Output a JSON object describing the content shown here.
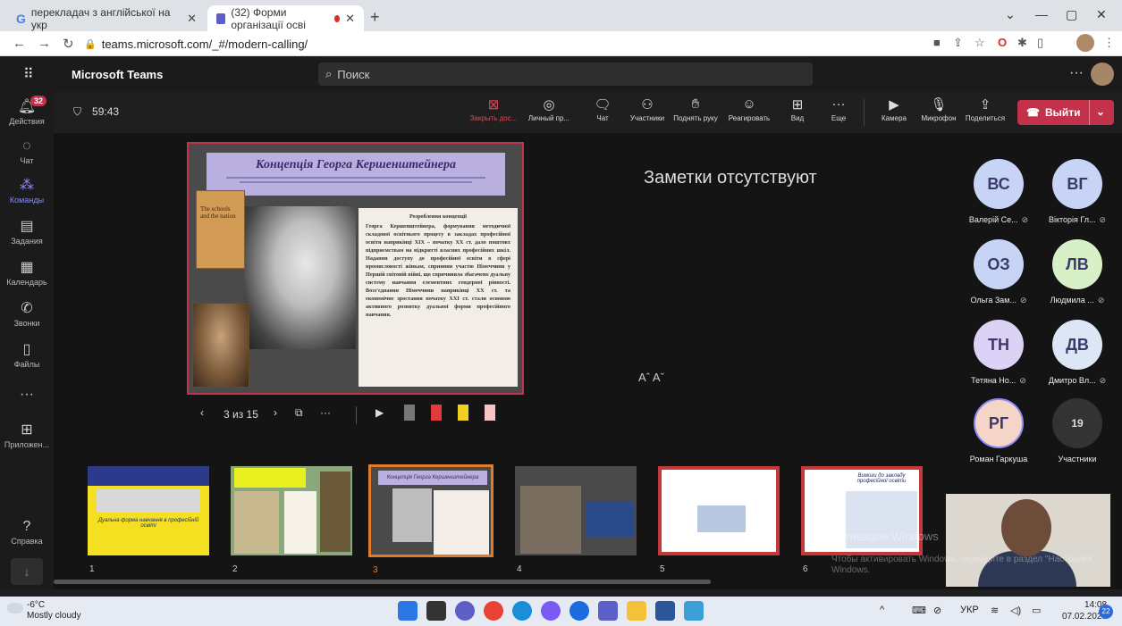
{
  "browser": {
    "tabs": [
      {
        "label": "перекладач з англійської на укр"
      },
      {
        "label": "(32) Форми організації осві"
      }
    ],
    "url": "teams.microsoft.com/_#/modern-calling/"
  },
  "teams": {
    "app_title": "Microsoft Teams",
    "search_placeholder": "Поиск",
    "rail": [
      {
        "label": "Действия",
        "badge": "32",
        "icon": "bell-icon"
      },
      {
        "label": "Чат",
        "icon": "chat-icon"
      },
      {
        "label": "Команды",
        "icon": "teams-icon"
      },
      {
        "label": "Задания",
        "icon": "assignments-icon"
      },
      {
        "label": "Календарь",
        "icon": "calendar-icon"
      },
      {
        "label": "Звонки",
        "icon": "phone-icon"
      },
      {
        "label": "Файлы",
        "icon": "file-icon"
      },
      {
        "label": "Приложен...",
        "icon": "apps-icon"
      },
      {
        "label": "Справка",
        "icon": "help-icon"
      }
    ]
  },
  "meeting": {
    "timer": "59:43",
    "controls": [
      {
        "label": "Закрыть дос...",
        "icon": "close-share-icon"
      },
      {
        "label": "Личный пр...",
        "icon": "eye-icon"
      },
      {
        "label": "Чат",
        "icon": "chat-icon"
      },
      {
        "label": "Участники",
        "icon": "people-icon"
      },
      {
        "label": "Поднять руку",
        "icon": "hand-icon"
      },
      {
        "label": "Реагировать",
        "icon": "emoji-icon"
      },
      {
        "label": "Вид",
        "icon": "grid-icon"
      },
      {
        "label": "Еще",
        "icon": "more-icon"
      },
      {
        "label": "Камера",
        "icon": "camera-icon"
      },
      {
        "label": "Микрофон",
        "icon": "mic-icon"
      },
      {
        "label": "Поделиться",
        "icon": "share-icon"
      }
    ],
    "leave_label": "Выйти",
    "notes_empty": "Заметки отсутствуют",
    "font_size_controls": "Aˆ Aˇ",
    "slide_counter": "3 из 15",
    "participants_count": "19",
    "participants_label": "Участники",
    "windows_watermark": "Активация Windows",
    "windows_watermark2": "Чтобы активировать Windows, перейдите в раздел \"Настройки\".",
    "windows_watermark3": "Windows."
  },
  "slide": {
    "title": "Концепція Георга Кершенштейнера",
    "book_title": "The schools and the nation",
    "text_heading": "Розроблення концепції",
    "text_body": "Георга Кершенштейнера, формування методичної складової освітнього процесу в закладах професійної освіти наприкінці XIX – початку XX ст. дало поштовх підприємствам на відкритті власних професійних шкіл. Надання доступу до професійної освіти в сфері промисловості жінкам, сприяння участю Німеччини у Першій світовій війні, що спричинила збагачено дуальну систему навчання елементних гендерної рівності. Возз'єднання Німеччини наприкінці XX ст. та економічне зростання початку XXI ст. стали основою активного розвитку дуальної форми професійного навчання."
  },
  "thumbnails": [
    {
      "num": "1",
      "caption": "Дуальна форма навчання в професійній освіті"
    },
    {
      "num": "2"
    },
    {
      "num": "3",
      "caption": "Концепція Георга Кершенштейнера"
    },
    {
      "num": "4"
    },
    {
      "num": "5"
    },
    {
      "num": "6",
      "caption": "Вимоги до закладу професійної освіти"
    }
  ],
  "participants": [
    {
      "initials": "ВС",
      "name": "Валерій Се...",
      "color": "#c7d4f5"
    },
    {
      "initials": "ВГ",
      "name": "Вікторія Гл...",
      "color": "#c7d4f5"
    },
    {
      "initials": "ОЗ",
      "name": "Ольга Зам...",
      "color": "#c7d4f5"
    },
    {
      "initials": "ЛВ",
      "name": "Людмила ...",
      "color": "#d8f0c8"
    },
    {
      "initials": "ТН",
      "name": "Тетяна Но...",
      "color": "#dcd2f5"
    },
    {
      "initials": "ДВ",
      "name": "Дмитро Вл...",
      "color": "#dde6f5"
    },
    {
      "initials": "РГ",
      "name": "Роман Гаркуша",
      "color": "#f5d5c7"
    }
  ],
  "taskbar": {
    "temp": "-6°C",
    "weather": "Mostly cloudy",
    "lang": "УКР",
    "time": "14:08",
    "date": "07.02.2023",
    "notif": "22"
  }
}
